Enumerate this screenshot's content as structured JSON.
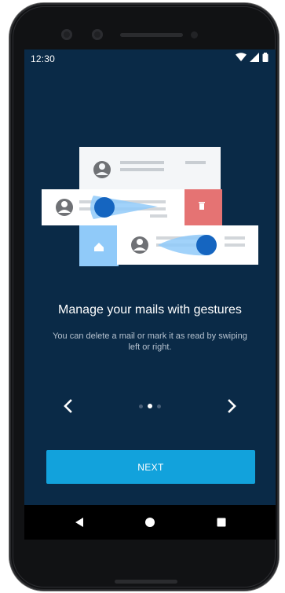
{
  "status_bar": {
    "time": "12:30",
    "icons": [
      "wifi-icon",
      "signal-icon",
      "battery-icon"
    ]
  },
  "onboarding": {
    "headline": "Manage your mails with gestures",
    "description": "You can delete a mail or mark it as read by swiping left or right.",
    "pager": {
      "total_pages": 3,
      "current_page": 2,
      "prev_icon": "chevron-left-icon",
      "next_icon": "chevron-right-icon"
    },
    "next_button_label": "NEXT"
  },
  "system_nav": {
    "icons": [
      "back-triangle-icon",
      "home-circle-icon",
      "recents-square-icon"
    ]
  },
  "colors": {
    "screen_background": "#0a2a47",
    "accent": "#12a2dc",
    "delete_action": "#e57373",
    "read_action": "#90caf9",
    "swipe_handle": "#1565c0"
  }
}
